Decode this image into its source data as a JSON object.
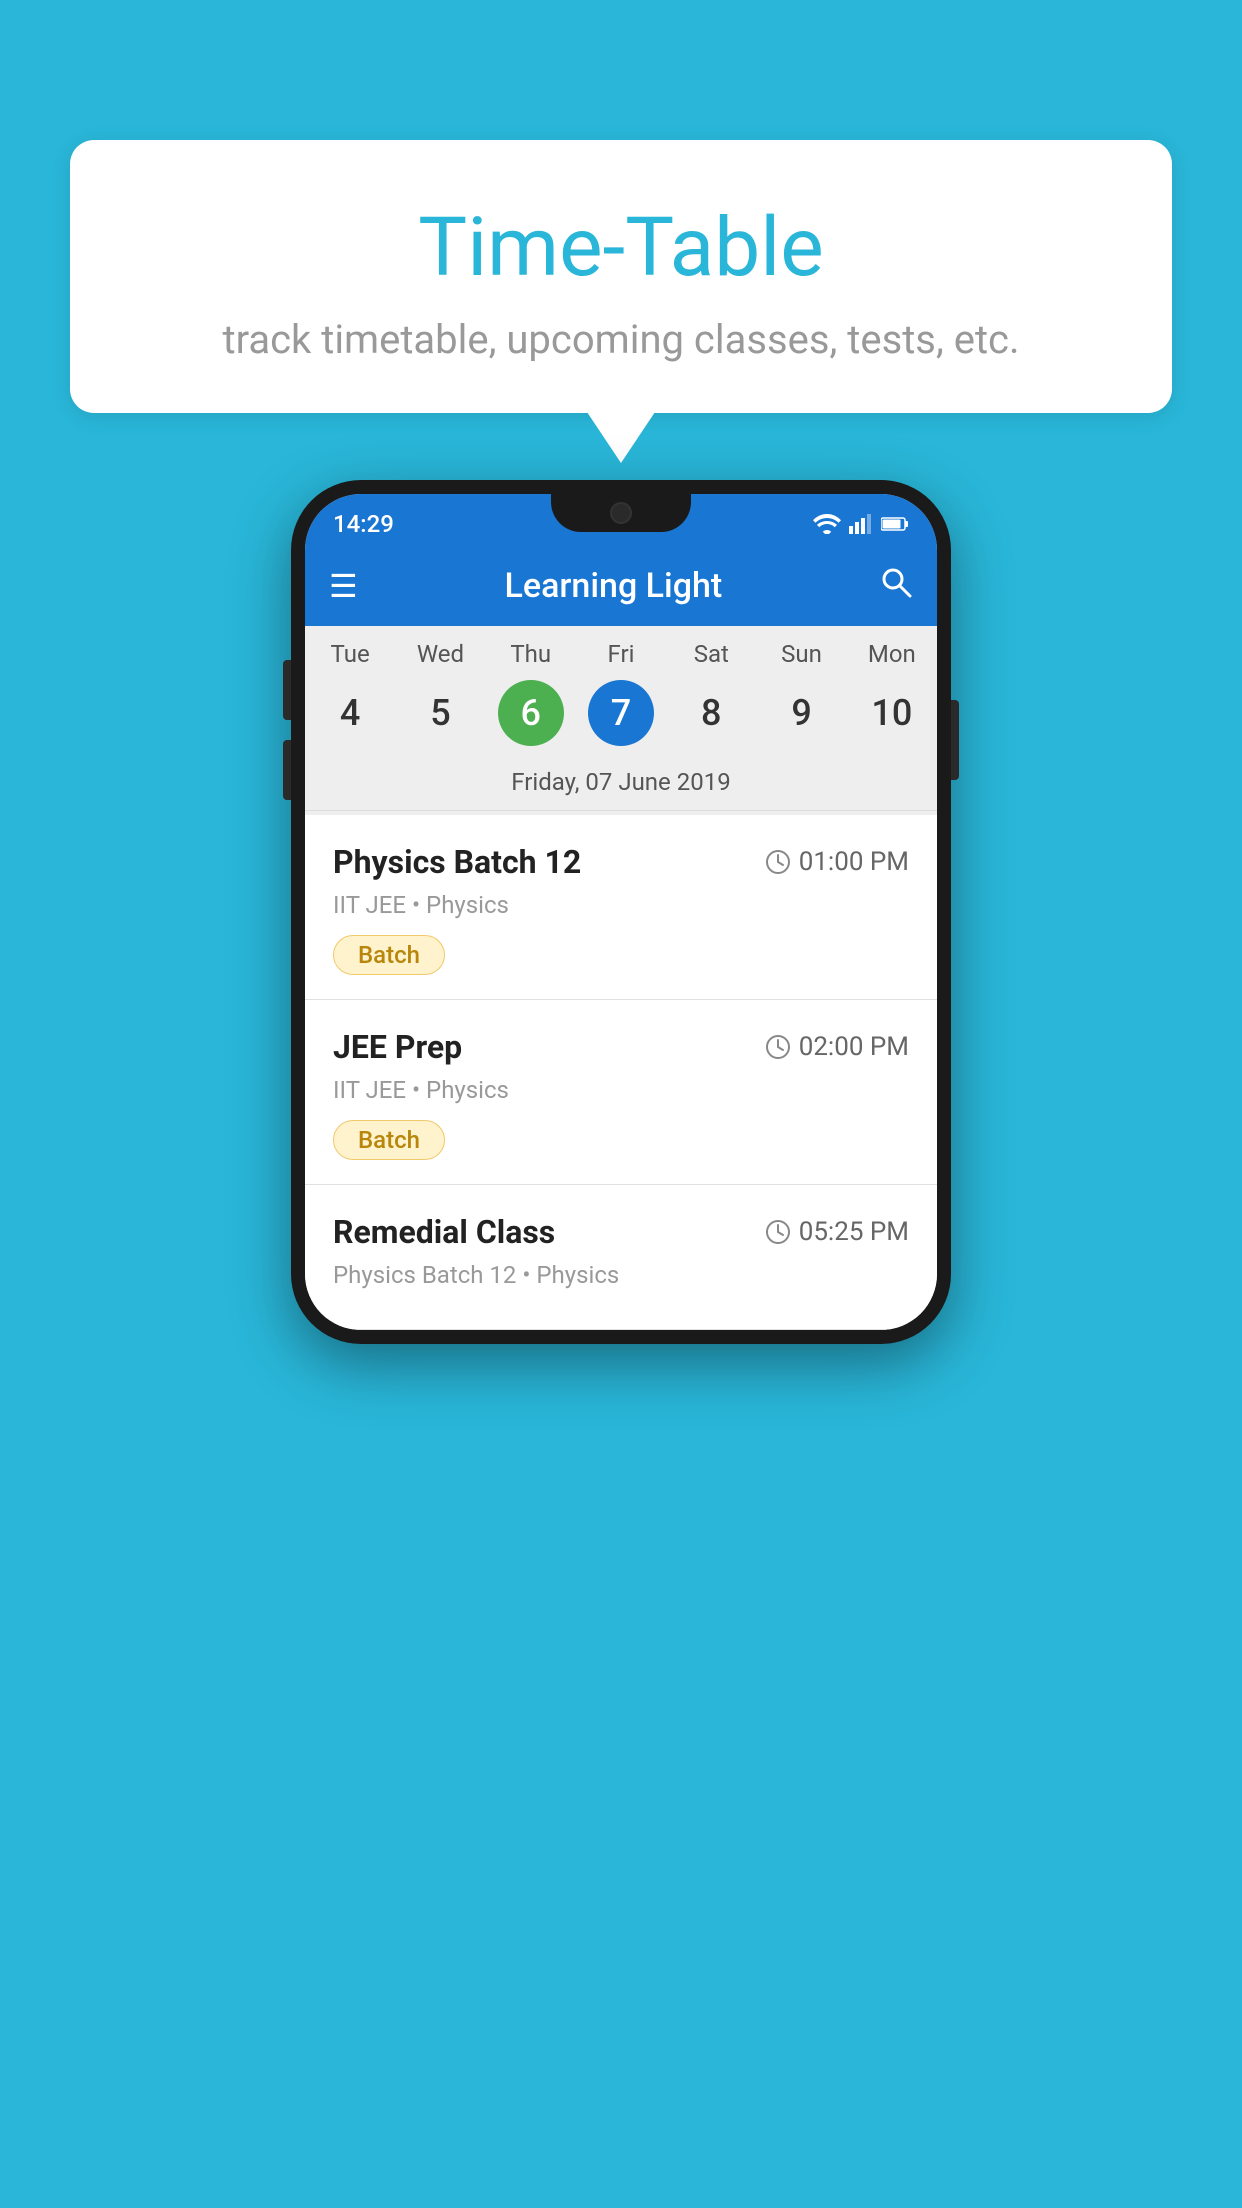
{
  "background_color": "#29b6d8",
  "bubble": {
    "title": "Time-Table",
    "subtitle": "track timetable, upcoming classes, tests, etc."
  },
  "phone": {
    "status_bar": {
      "time": "14:29",
      "icons": [
        "wifi",
        "signal",
        "battery"
      ]
    },
    "app_bar": {
      "title": "Learning Light",
      "hamburger_label": "☰",
      "search_label": "🔍"
    },
    "calendar": {
      "weekdays": [
        "Tue",
        "Wed",
        "Thu",
        "Fri",
        "Sat",
        "Sun",
        "Mon"
      ],
      "dates": [
        {
          "number": "4",
          "state": "normal"
        },
        {
          "number": "5",
          "state": "normal"
        },
        {
          "number": "6",
          "state": "today"
        },
        {
          "number": "7",
          "state": "selected"
        },
        {
          "number": "8",
          "state": "normal"
        },
        {
          "number": "9",
          "state": "normal"
        },
        {
          "number": "10",
          "state": "normal"
        }
      ],
      "selected_date_label": "Friday, 07 June 2019"
    },
    "classes": [
      {
        "name": "Physics Batch 12",
        "time": "01:00 PM",
        "meta": "IIT JEE • Physics",
        "badge": "Batch"
      },
      {
        "name": "JEE Prep",
        "time": "02:00 PM",
        "meta": "IIT JEE • Physics",
        "badge": "Batch"
      },
      {
        "name": "Remedial Class",
        "time": "05:25 PM",
        "meta": "Physics Batch 12 • Physics",
        "badge": null
      }
    ]
  }
}
